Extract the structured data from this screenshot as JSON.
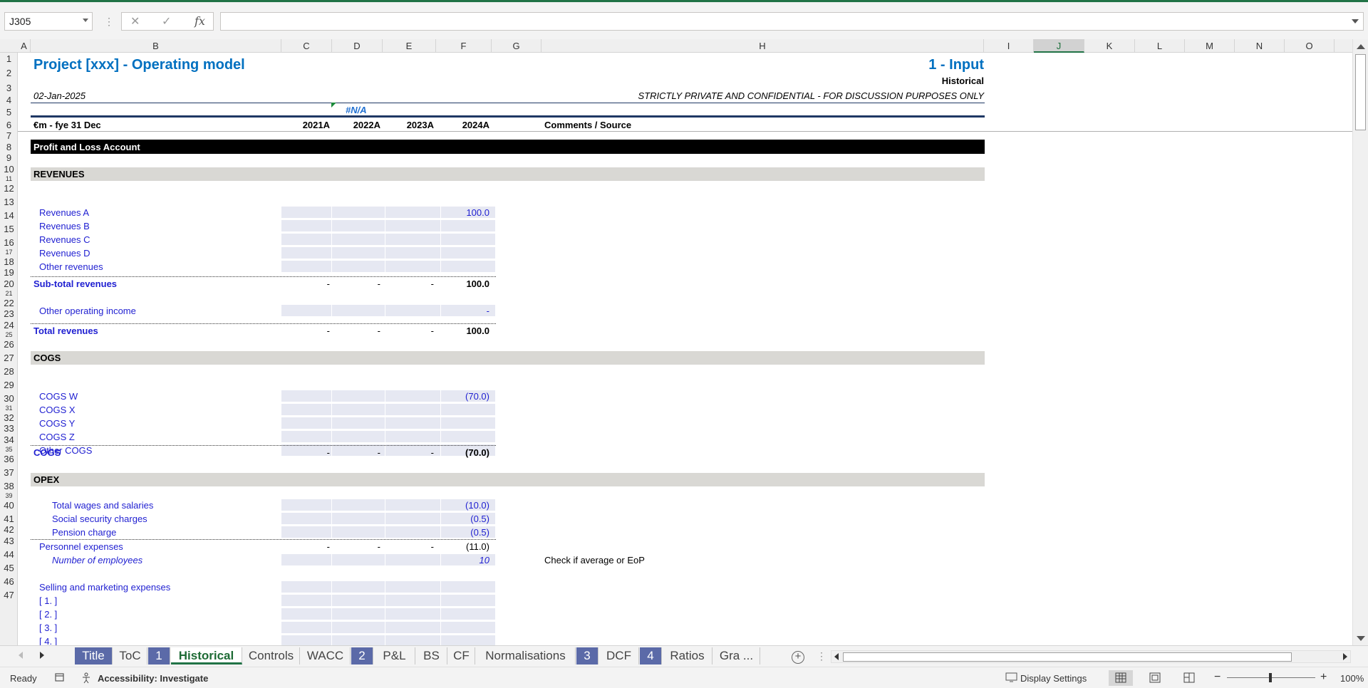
{
  "formula_bar": {
    "name_box": "J305",
    "cancel_glyph": "✕",
    "enter_glyph": "✓",
    "fx_label": "fx",
    "formula": ""
  },
  "columns": [
    "A",
    "B",
    "C",
    "D",
    "E",
    "F",
    "G",
    "H",
    "I",
    "J",
    "K",
    "L",
    "M",
    "N",
    "O"
  ],
  "selected_column": "J",
  "rows": [
    "1",
    "2",
    "3",
    "4",
    "5",
    "6",
    "7",
    "8",
    "9",
    "10",
    "11",
    "12",
    "13",
    "14",
    "15",
    "16",
    "17",
    "18",
    "19",
    "20",
    "21",
    "22",
    "23",
    "24",
    "25",
    "26",
    "27",
    "28",
    "29",
    "30",
    "31",
    "32",
    "33",
    "34",
    "35",
    "36",
    "37",
    "38",
    "39",
    "40",
    "41",
    "42",
    "43",
    "44",
    "45",
    "46",
    "47"
  ],
  "sheet": {
    "title": "Project [xxx] - Operating model",
    "section_title": "1 - Input",
    "subtitle": "Historical",
    "date": "02-Jan-2025",
    "confidential": "STRICTLY PRIVATE AND CONFIDENTIAL - FOR DISCUSSION PURPOSES ONLY",
    "na_value": "#N/A",
    "units_label": "€m - fye 31 Dec",
    "years": [
      "2021A",
      "2022A",
      "2023A",
      "2024A"
    ],
    "comments_header": "Comments / Source",
    "pl_header": "Profit and Loss Account",
    "revenues_header": "REVENUES",
    "revenue_items": [
      {
        "label": "Revenues A",
        "value": "100.0"
      },
      {
        "label": "Revenues B",
        "value": ""
      },
      {
        "label": "Revenues C",
        "value": ""
      },
      {
        "label": "Revenues D",
        "value": ""
      },
      {
        "label": "Other revenues",
        "value": ""
      }
    ],
    "subtotal_revenues": {
      "label": "Sub-total revenues",
      "values": [
        "-",
        "-",
        "-",
        "100.0"
      ]
    },
    "other_operating_income": {
      "label": "Other operating income",
      "value": "-"
    },
    "total_revenues": {
      "label": "Total revenues",
      "values": [
        "-",
        "-",
        "-",
        "100.0"
      ]
    },
    "cogs_header": "COGS",
    "cogs_items": [
      {
        "label": "COGS W",
        "value": "(70.0)"
      },
      {
        "label": "COGS X",
        "value": ""
      },
      {
        "label": "COGS Y",
        "value": ""
      },
      {
        "label": "COGS Z",
        "value": ""
      },
      {
        "label": "Other COGS",
        "value": ""
      }
    ],
    "cogs_total": {
      "label": "COGS",
      "values": [
        "-",
        "-",
        "-",
        "(70.0)"
      ]
    },
    "opex_header": "OPEX",
    "personnel_items": [
      {
        "label": "Total wages and salaries",
        "value": "(10.0)"
      },
      {
        "label": "Social security charges",
        "value": "(0.5)"
      },
      {
        "label": "Pension charge",
        "value": "(0.5)"
      }
    ],
    "personnel_total": {
      "label": "Personnel expenses",
      "values": [
        "-",
        "-",
        "-",
        "(11.0)"
      ]
    },
    "employees": {
      "label": "Number of employees",
      "value": "10",
      "comment": "Check if average or EoP"
    },
    "selling_label": "Selling and marketing expenses",
    "selling_items": [
      "[ 1. ]",
      "[ 2. ]",
      "[ 3. ]",
      "[ 4. ]"
    ]
  },
  "tabs": [
    {
      "label": "Title",
      "style": "colored"
    },
    {
      "label": "ToC",
      "style": "plain"
    },
    {
      "label": "1",
      "style": "colored"
    },
    {
      "label": "Historical",
      "style": "active"
    },
    {
      "label": "Controls",
      "style": "plain"
    },
    {
      "label": "WACC",
      "style": "plain"
    },
    {
      "label": "2",
      "style": "colored"
    },
    {
      "label": "P&L",
      "style": "plain"
    },
    {
      "label": "BS",
      "style": "plain"
    },
    {
      "label": "CF",
      "style": "plain"
    },
    {
      "label": "Normalisations",
      "style": "plain"
    },
    {
      "label": "3",
      "style": "colored"
    },
    {
      "label": "DCF",
      "style": "plain"
    },
    {
      "label": "4",
      "style": "colored"
    },
    {
      "label": "Ratios",
      "style": "plain"
    },
    {
      "label": "Gra ...",
      "style": "plain"
    }
  ],
  "status": {
    "ready": "Ready",
    "accessibility": "Accessibility: Investigate",
    "display_settings": "Display Settings",
    "zoom": "100%",
    "zoom_minus": "−",
    "zoom_plus": "+"
  },
  "colors": {
    "excel_green": "#217346",
    "title_blue": "#0070c0",
    "input_blue": "#1f1fd1",
    "input_fill": "#e6e8f2",
    "section_grey": "#d9d8d4",
    "tab_colored": "#5b6aa8"
  }
}
